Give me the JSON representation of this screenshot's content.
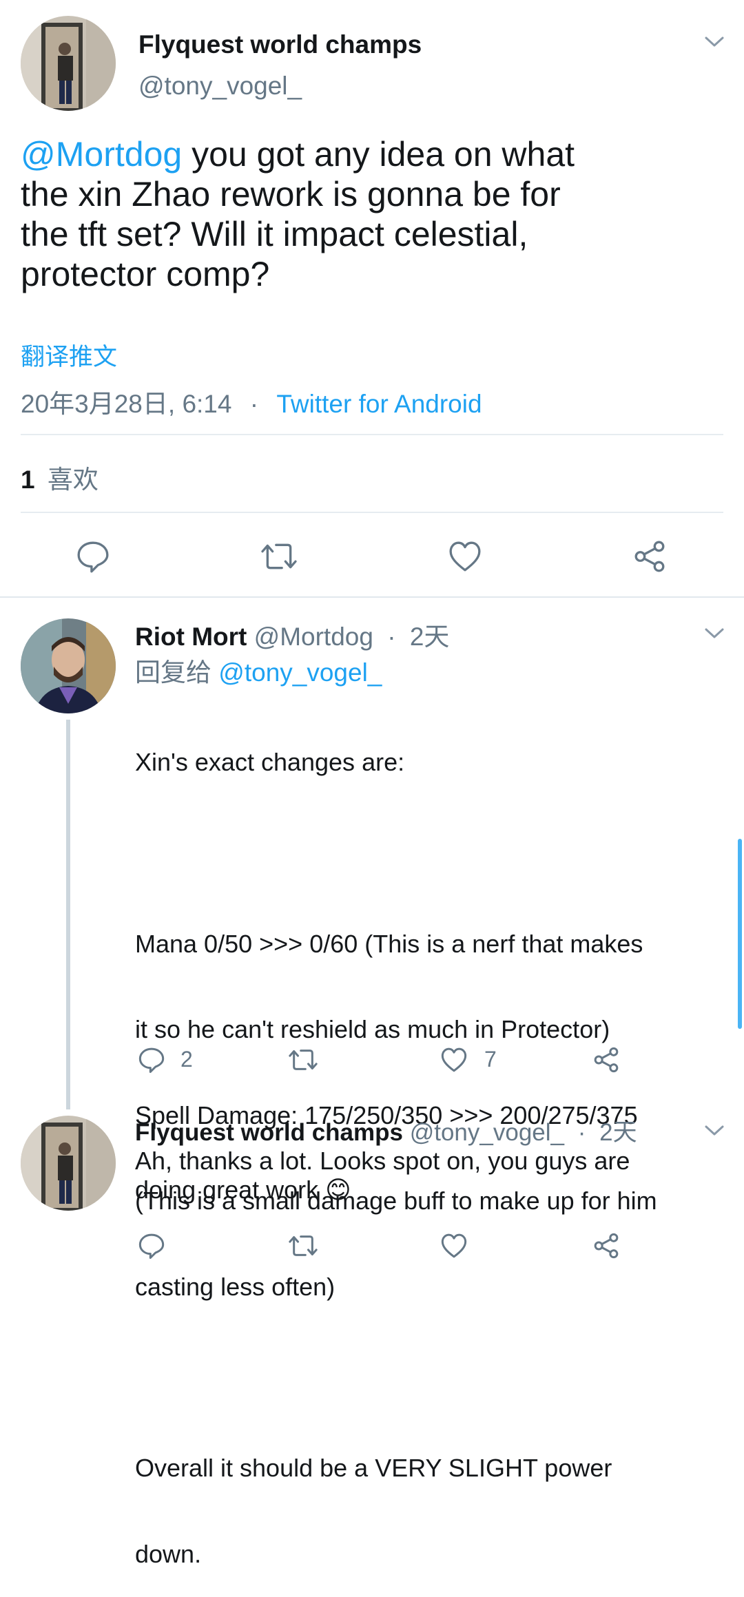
{
  "main_tweet": {
    "display_name": "Flyquest world champs",
    "handle": "@tony_vogel_",
    "mention": "@Mortdog",
    "text_line1": " you got any idea on what",
    "text_line2": "the xin Zhao rework is gonna be for",
    "text_line3": "the tft set? Will it impact celestial,",
    "text_line4": "protector comp?",
    "translate_label": "翻译推文",
    "timestamp": "20年3月28日, 6:14",
    "separator": "·",
    "source": "Twitter for Android",
    "likes_count": "1",
    "likes_label": "喜欢"
  },
  "reply1": {
    "display_name": "Riot Mort",
    "handle": "@Mortdog",
    "separator": "·",
    "time": "2天",
    "reply_to_label": "回复给",
    "reply_to_handle": "@tony_vogel_",
    "lines": [
      "Xin's exact changes are:",
      "",
      "Mana 0/50 >>> 0/60 (This is a nerf that makes",
      "it so he can't reshield as much in Protector)",
      "Spell Damage: 175/250/350 >>> 200/275/375",
      "(This is a small damage buff to make up for him",
      "casting less often)",
      "",
      "Overall it should be a VERY SLIGHT power",
      "down."
    ],
    "reply_count": "2",
    "like_count": "7"
  },
  "reply2": {
    "display_name": "Flyquest world champs",
    "handle": "@tony_vogel_",
    "separator": "·",
    "time": "2天",
    "line1": "Ah, thanks a lot. Looks spot on, you guys are",
    "line2": "doing great work",
    "emoji": "😊"
  },
  "colors": {
    "accent": "#1da1f2",
    "secondary_text": "#657786",
    "divider": "#e6ecf0",
    "icon": "#657786"
  }
}
